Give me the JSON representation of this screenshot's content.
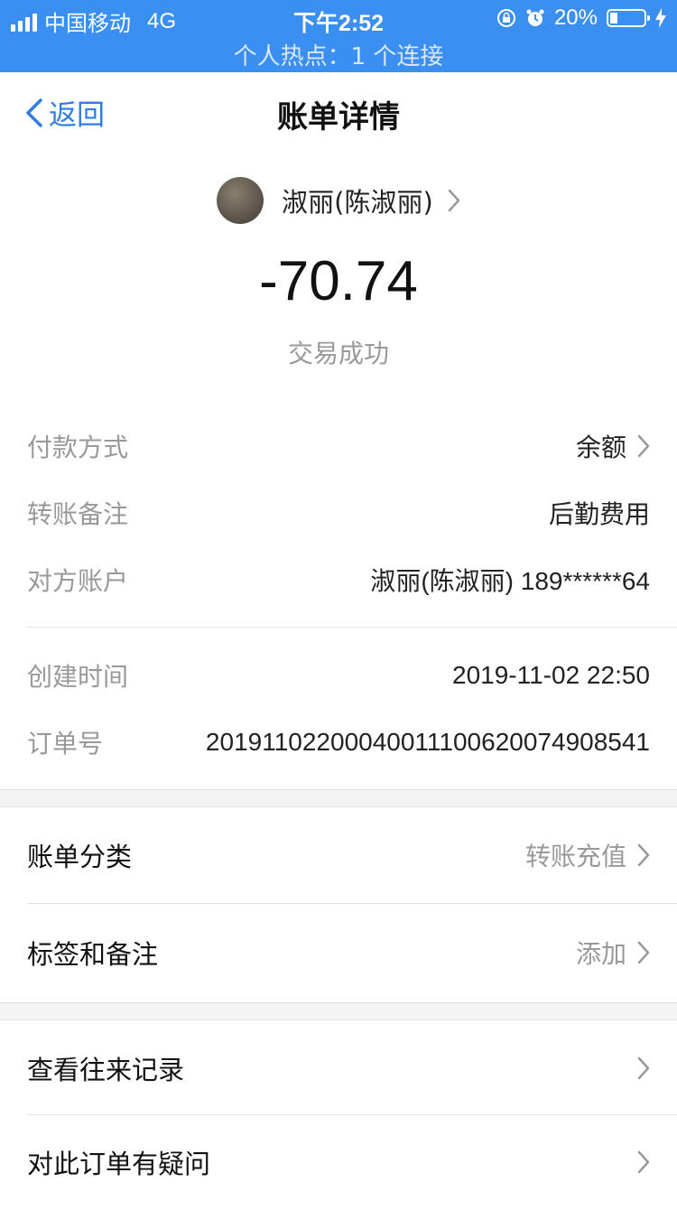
{
  "status": {
    "carrier": "中国移动",
    "network": "4G",
    "time": "下午2:52",
    "battery": "20%",
    "hotspot": "个人热点：1 个连接"
  },
  "nav": {
    "back": "返回",
    "title": "账单详情"
  },
  "payee": {
    "name": "淑丽(陈淑丽)",
    "amount": "-70.74",
    "status": "交易成功"
  },
  "details": [
    {
      "label": "付款方式",
      "value": "余额"
    },
    {
      "label": "转账备注",
      "value": "后勤费用"
    },
    {
      "label": "对方账户",
      "value": "淑丽(陈淑丽) 189******64"
    },
    {
      "label": "创建时间",
      "value": "2019-11-02 22:50"
    },
    {
      "label": "订单号",
      "value": "20191102200040011100620074908541"
    }
  ],
  "actions": [
    {
      "label": "账单分类",
      "value": "转账充值"
    },
    {
      "label": "标签和备注",
      "value": "添加"
    },
    {
      "label": "查看往来记录",
      "value": ""
    },
    {
      "label": "对此订单有疑问",
      "value": ""
    }
  ],
  "colors": {
    "status_bar": "#3b8ff0",
    "accent": "#2f7de1"
  }
}
